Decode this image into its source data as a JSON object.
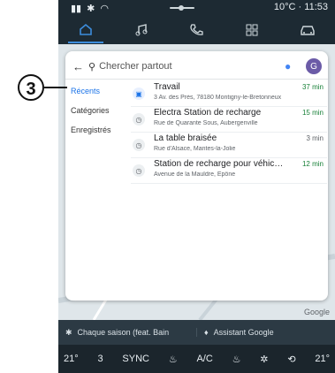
{
  "callout": {
    "number": "3"
  },
  "status_bar": {
    "weather_time": "10°C · 11:53"
  },
  "tabs": [
    {
      "name": "home-icon",
      "active": true
    },
    {
      "name": "music-icon",
      "active": false
    },
    {
      "name": "phone-icon",
      "active": false
    },
    {
      "name": "apps-icon",
      "active": false
    },
    {
      "name": "car-icon",
      "active": false
    }
  ],
  "search": {
    "placeholder": "Chercher partout",
    "avatar_letter": "G"
  },
  "sidebar": {
    "items": [
      {
        "label": "Récents",
        "active": true
      },
      {
        "label": "Catégories",
        "active": false
      },
      {
        "label": "Enregistrés",
        "active": false
      }
    ]
  },
  "results": [
    {
      "title": "Travail",
      "subtitle": "3 Av. des Prés, 78180 Montigny-le-Bretonneux",
      "time": "37 min",
      "icon": "briefcase-icon"
    },
    {
      "title": "Electra Station de recharge",
      "subtitle": "Rue de Quarante Sous, Aubergenville",
      "time": "15 min",
      "icon": "history-icon"
    },
    {
      "title": "La table braisée",
      "subtitle": "Rue d'Alsace, Mantes-la-Jolie",
      "time": "3 min",
      "icon": "history-icon"
    },
    {
      "title": "Station de recharge pour véhicul...",
      "subtitle": "Avenue de la Mauldre, Épône",
      "time": "12 min",
      "icon": "history-icon"
    }
  ],
  "map": {
    "attribution": "Google"
  },
  "media": {
    "song": "Chaque saison (feat. Bain",
    "assistant": "Assistant Google"
  },
  "climate": {
    "left_temp": "21°",
    "seat_level": "3",
    "sync": "SYNC",
    "ac": "A/C",
    "right_temp": "21°"
  },
  "colors": {
    "accent": "#3d8ddd",
    "time_green": "#188038"
  }
}
